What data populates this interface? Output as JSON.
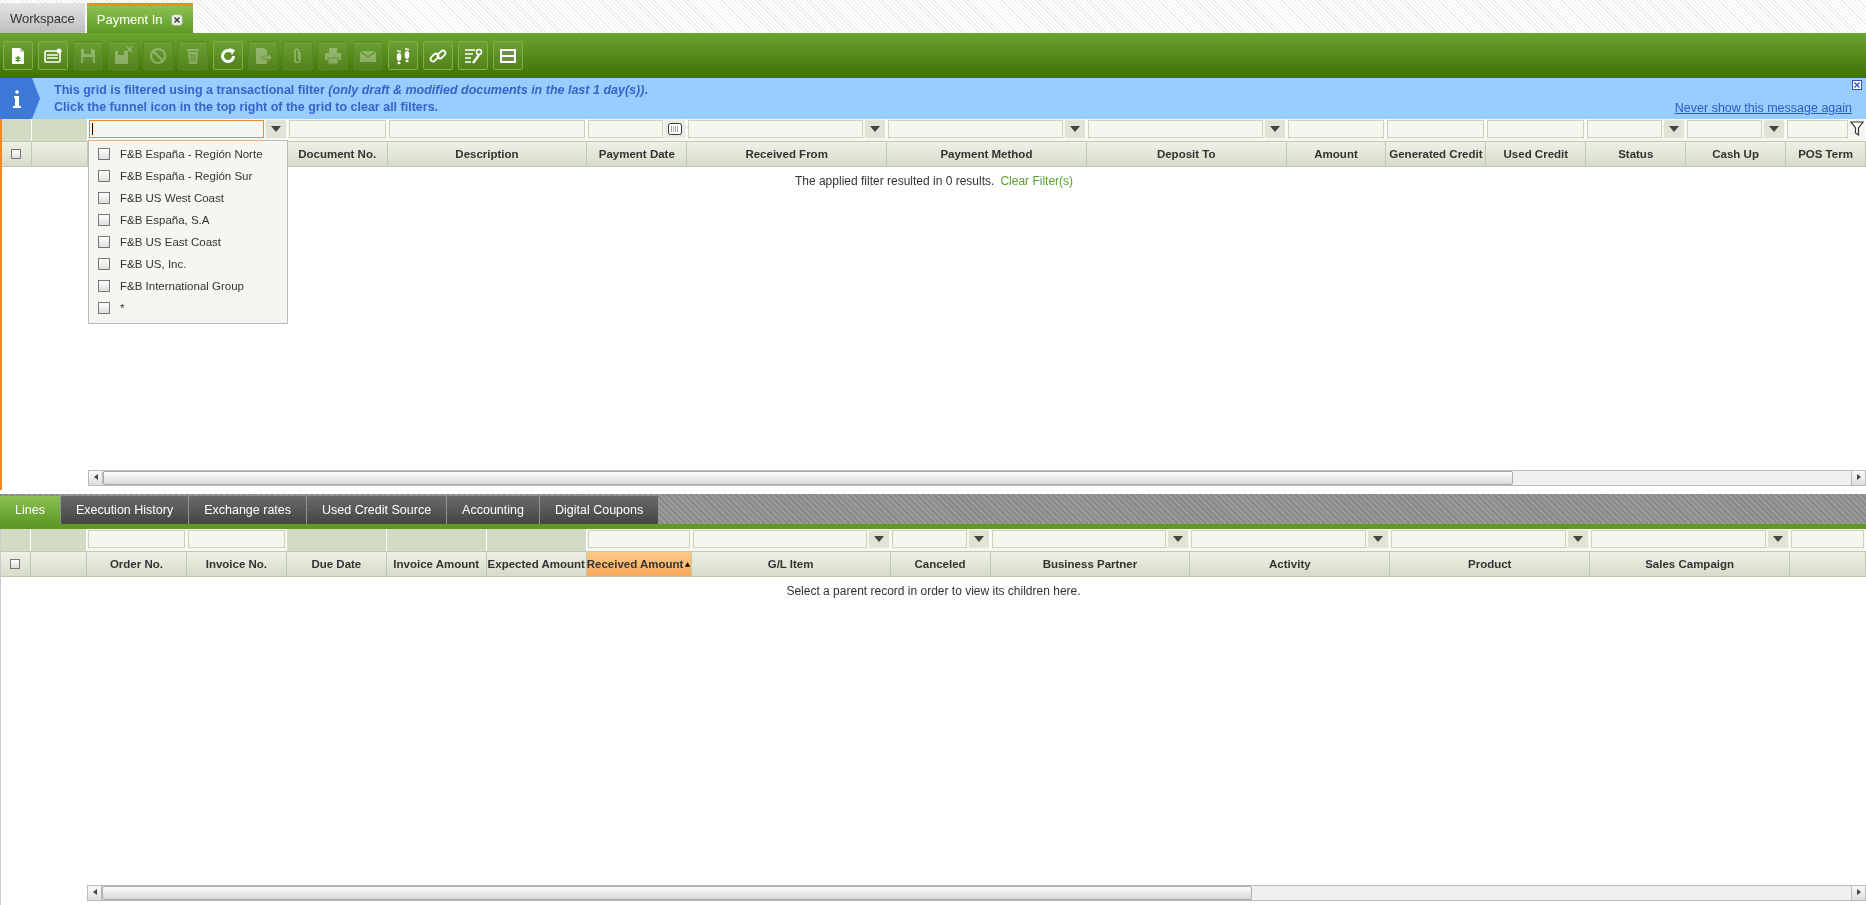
{
  "workspace_tabs": [
    {
      "label": "Workspace",
      "selected": false,
      "closable": false
    },
    {
      "label": "Payment In",
      "selected": true,
      "closable": true
    }
  ],
  "toolbar": [
    {
      "kind": "new-document",
      "disabled": false
    },
    {
      "kind": "new-form",
      "disabled": false
    },
    {
      "kind": "save",
      "disabled": true
    },
    {
      "kind": "save-close",
      "disabled": true
    },
    {
      "kind": "cancel",
      "disabled": true
    },
    {
      "kind": "delete",
      "disabled": true
    },
    {
      "kind": "refresh",
      "disabled": false
    },
    {
      "kind": "export",
      "disabled": true
    },
    {
      "kind": "attach",
      "disabled": true
    },
    {
      "kind": "print",
      "disabled": true
    },
    {
      "kind": "email",
      "disabled": true
    },
    {
      "kind": "audit",
      "disabled": false
    },
    {
      "kind": "link",
      "disabled": false
    },
    {
      "kind": "tools",
      "disabled": false
    },
    {
      "kind": "layout",
      "disabled": false
    }
  ],
  "info_message": {
    "line_1": "This grid is filtered using a transactional filter *(only draft & modified documents in the last 1 day(s))*.",
    "line_2": "Click the funnel icon in the top right of the grid to clear all filters.",
    "link": "Never show this message again"
  },
  "header_grid": {
    "select_all_checked": false,
    "columns": [
      {
        "kind": "dropdown",
        "focused": true
      },
      {
        "heading": "Document No.",
        "kind": "text",
        "focused": false,
        "sorted": false
      },
      {
        "heading": "Description",
        "kind": "text",
        "focused": false,
        "sorted": false
      },
      {
        "heading": "Payment Date",
        "kind": "date",
        "focused": false,
        "sorted": false
      },
      {
        "heading": "Received From",
        "kind": "dropdown",
        "focused": false,
        "sorted": false
      },
      {
        "heading": "Payment Method",
        "kind": "dropdown",
        "focused": false,
        "sorted": false
      },
      {
        "heading": "Deposit To",
        "kind": "dropdown",
        "focused": false,
        "sorted": false
      },
      {
        "heading": "Amount",
        "kind": "text",
        "focused": false,
        "sorted": false
      },
      {
        "heading": "Generated Credit",
        "kind": "text",
        "focused": false,
        "sorted": false
      },
      {
        "heading": "Used Credit",
        "kind": "text",
        "focused": false,
        "sorted": false
      },
      {
        "heading": "Status",
        "kind": "dropdown",
        "focused": false,
        "sorted": false
      },
      {
        "heading": "Cash Up",
        "kind": "dropdown",
        "focused": false,
        "sorted": false
      },
      {
        "heading": "POS Term",
        "kind": "funnel",
        "focused": false,
        "sorted": false
      }
    ],
    "filter_dropdown": [
      {
        "label": "F&B España - Región Norte",
        "checked": false
      },
      {
        "label": "F&B España - Región Sur",
        "checked": false
      },
      {
        "label": "F&B US West Coast",
        "checked": false
      },
      {
        "label": "F&B España, S.A",
        "checked": false
      },
      {
        "label": "F&B US East Coast",
        "checked": false
      },
      {
        "label": "F&B US, Inc.",
        "checked": false
      },
      {
        "label": "F&B International Group",
        "checked": false
      },
      {
        "label": "*",
        "checked": false
      }
    ],
    "message": "The applied filter resulted in 0 results.",
    "message_link": "Clear Filter(s)"
  },
  "detail_tabs": [
    {
      "label": "Lines",
      "selected": true
    },
    {
      "label": "Execution History",
      "selected": false
    },
    {
      "label": "Exchange rates",
      "selected": false
    },
    {
      "label": "Used Credit Source",
      "selected": false
    },
    {
      "label": "Accounting",
      "selected": false
    },
    {
      "label": "Digital Coupons",
      "selected": false
    }
  ],
  "lines_grid": {
    "select_all_checked": false,
    "columns": [
      {
        "heading": "Order No.",
        "kind": "text",
        "sorted": false
      },
      {
        "heading": "Invoice No.",
        "kind": "text",
        "sorted": false
      },
      {
        "heading": "Due Date",
        "kind": "none",
        "sorted": false
      },
      {
        "heading": "Invoice Amount",
        "kind": "none",
        "sorted": false
      },
      {
        "heading": "Expected Amount",
        "kind": "none",
        "sorted": false
      },
      {
        "heading": "Received Amount",
        "kind": "text",
        "sorted": true
      },
      {
        "heading": "G/L Item",
        "kind": "dropdown",
        "sorted": false
      },
      {
        "heading": "Canceled",
        "kind": "dropdown",
        "sorted": false
      },
      {
        "heading": "Business Partner",
        "kind": "dropdown",
        "sorted": false
      },
      {
        "heading": "Activity",
        "kind": "dropdown",
        "sorted": false
      },
      {
        "heading": "Product",
        "kind": "dropdown",
        "sorted": false
      },
      {
        "heading": "Sales Campaign",
        "kind": "dropdown",
        "sorted": false
      },
      {
        "kind": "text",
        "sorted": false
      }
    ],
    "message": "Select a parent record in order to view its children here."
  }
}
